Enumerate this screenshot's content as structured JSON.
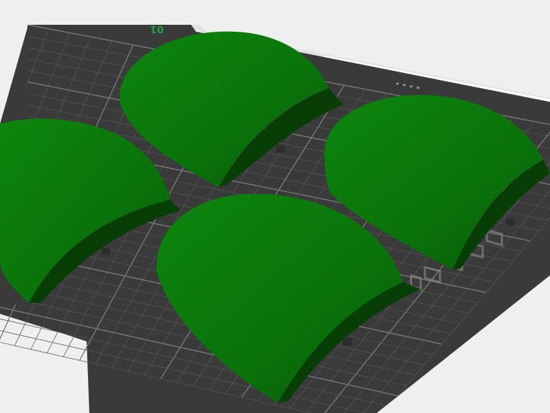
{
  "viewport": {
    "plate_number": "01",
    "colors": {
      "background": "#efefef",
      "bed": "#3a3a3a",
      "bed_edge": "#e4e4e4",
      "grid_minor": "#555555",
      "grid_major": "#7a7a7a",
      "object_light": "#0e8e0e",
      "object_mid": "#0a6e0a",
      "object_dark": "#064406",
      "label_green": "#1fa34a"
    },
    "objects": [
      {
        "name": "arch-object-back"
      },
      {
        "name": "arch-object-left"
      },
      {
        "name": "arch-object-right"
      },
      {
        "name": "arch-object-front"
      }
    ]
  }
}
